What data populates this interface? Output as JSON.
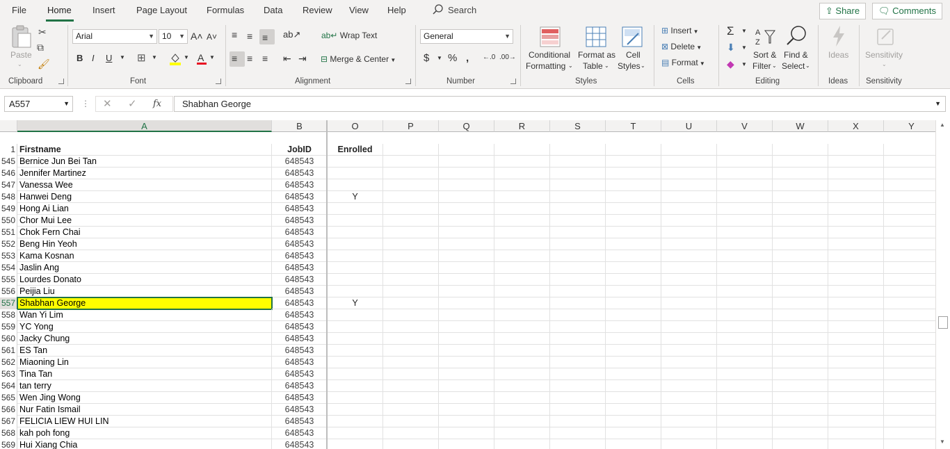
{
  "menu": {
    "tabs": [
      "File",
      "Home",
      "Insert",
      "Page Layout",
      "Formulas",
      "Data",
      "Review",
      "View",
      "Help"
    ],
    "search": "Search",
    "share": "Share",
    "comments": "Comments"
  },
  "ribbon": {
    "clipboard": {
      "paste": "Paste",
      "label": "Clipboard"
    },
    "font": {
      "name": "Arial",
      "size": "10",
      "label": "Font"
    },
    "alignment": {
      "wrap": "Wrap Text",
      "merge": "Merge & Center",
      "label": "Alignment"
    },
    "number": {
      "format": "General",
      "label": "Number"
    },
    "styles": {
      "conditional1": "Conditional",
      "conditional2": "Formatting",
      "format_as1": "Format as",
      "format_as2": "Table",
      "cell1": "Cell",
      "cell2": "Styles",
      "label": "Styles"
    },
    "cells": {
      "insert": "Insert",
      "delete": "Delete",
      "format": "Format",
      "label": "Cells"
    },
    "editing": {
      "sort1": "Sort &",
      "sort2": "Filter",
      "find1": "Find &",
      "find2": "Select",
      "label": "Editing"
    },
    "ideas": {
      "btn": "Ideas",
      "label": "Ideas"
    },
    "sensitivity": {
      "btn": "Sensitivity",
      "label": "Sensitivity"
    }
  },
  "formula_bar": {
    "name_box": "A557",
    "fx": "fx",
    "value": "Shabhan George"
  },
  "columns": [
    "A",
    "B",
    "O",
    "P",
    "Q",
    "R",
    "S",
    "T",
    "U",
    "V",
    "W",
    "X",
    "Y"
  ],
  "header_row": {
    "num": "1",
    "a": "Firstname",
    "b": "JobID",
    "o": "Enrolled"
  },
  "rows": [
    {
      "num": "545",
      "name": "Bernice Jun Bei Tan",
      "job": "648543",
      "enrolled": ""
    },
    {
      "num": "546",
      "name": "Jennifer Martinez",
      "job": "648543",
      "enrolled": ""
    },
    {
      "num": "547",
      "name": "Vanessa Wee",
      "job": "648543",
      "enrolled": ""
    },
    {
      "num": "548",
      "name": "Hanwei Deng",
      "job": "648543",
      "enrolled": "Y"
    },
    {
      "num": "549",
      "name": "Hong Ai Lian",
      "job": "648543",
      "enrolled": ""
    },
    {
      "num": "550",
      "name": "Chor Mui Lee",
      "job": "648543",
      "enrolled": ""
    },
    {
      "num": "551",
      "name": "Chok Fern Chai",
      "job": "648543",
      "enrolled": ""
    },
    {
      "num": "552",
      "name": "Beng Hin Yeoh",
      "job": "648543",
      "enrolled": ""
    },
    {
      "num": "553",
      "name": "Kama Kosnan",
      "job": "648543",
      "enrolled": ""
    },
    {
      "num": "554",
      "name": "Jaslin Ang",
      "job": "648543",
      "enrolled": ""
    },
    {
      "num": "555",
      "name": "Lourdes Donato",
      "job": "648543",
      "enrolled": ""
    },
    {
      "num": "556",
      "name": "Peijia Liu",
      "job": "648543",
      "enrolled": ""
    },
    {
      "num": "557",
      "name": "Shabhan George",
      "job": "648543",
      "enrolled": "Y"
    },
    {
      "num": "558",
      "name": "Wan Yi Lim",
      "job": "648543",
      "enrolled": ""
    },
    {
      "num": "559",
      "name": "YC Yong",
      "job": "648543",
      "enrolled": ""
    },
    {
      "num": "560",
      "name": "Jacky Chung",
      "job": "648543",
      "enrolled": ""
    },
    {
      "num": "561",
      "name": "ES Tan",
      "job": "648543",
      "enrolled": ""
    },
    {
      "num": "562",
      "name": "Miaoning Lin",
      "job": "648543",
      "enrolled": ""
    },
    {
      "num": "563",
      "name": "Tina Tan",
      "job": "648543",
      "enrolled": ""
    },
    {
      "num": "564",
      "name": "tan terry",
      "job": "648543",
      "enrolled": ""
    },
    {
      "num": "565",
      "name": "Wen Jing Wong",
      "job": "648543",
      "enrolled": ""
    },
    {
      "num": "566",
      "name": "Nur Fatin Ismail",
      "job": "648543",
      "enrolled": ""
    },
    {
      "num": "567",
      "name": "FELICIA LIEW HUI LIN",
      "job": "648543",
      "enrolled": ""
    },
    {
      "num": "568",
      "name": "kah poh fong",
      "job": "648543",
      "enrolled": ""
    },
    {
      "num": "569",
      "name": "Hui Xiang Chia",
      "job": "648543",
      "enrolled": ""
    }
  ],
  "selected_row": "557",
  "colors": {
    "accent": "#217346",
    "highlight": "#ffff00"
  }
}
